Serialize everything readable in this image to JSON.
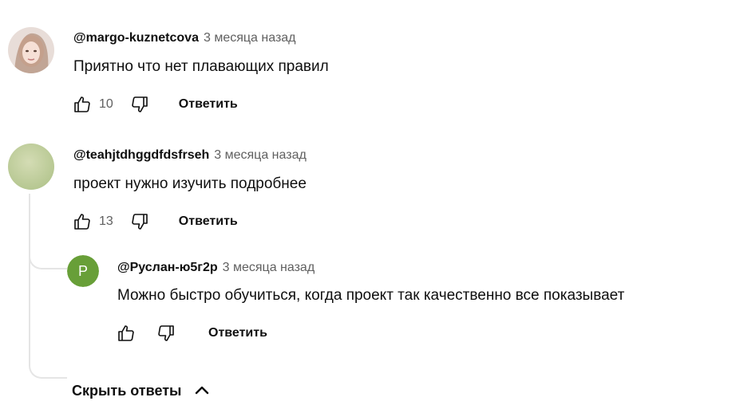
{
  "comments": [
    {
      "author": "@margo-kuznetcova",
      "time": "3 месяца назад",
      "text": "Приятно что нет плавающих правил",
      "likes": "10",
      "reply_label": "Ответить",
      "avatar": "photo-avatar-icon"
    },
    {
      "author": "@teahjtdhggdfdsfrseh",
      "time": "3 месяца назад",
      "text": "проект нужно изучить подробнее",
      "likes": "13",
      "reply_label": "Ответить",
      "avatar": "green-blurred-avatar-icon"
    }
  ],
  "replies": [
    {
      "author": "@Руслан-ю5г2р",
      "time": "3 месяца назад",
      "text": "Можно быстро обучиться, когда проект так качественно все показывает",
      "reply_label": "Ответить",
      "avatar_letter": "Р",
      "avatar_color": "#689f38"
    }
  ],
  "hide_replies_label": "Скрыть ответы",
  "icons": [
    "thumb-up-icon",
    "thumb-down-icon",
    "chevron-up-icon"
  ]
}
